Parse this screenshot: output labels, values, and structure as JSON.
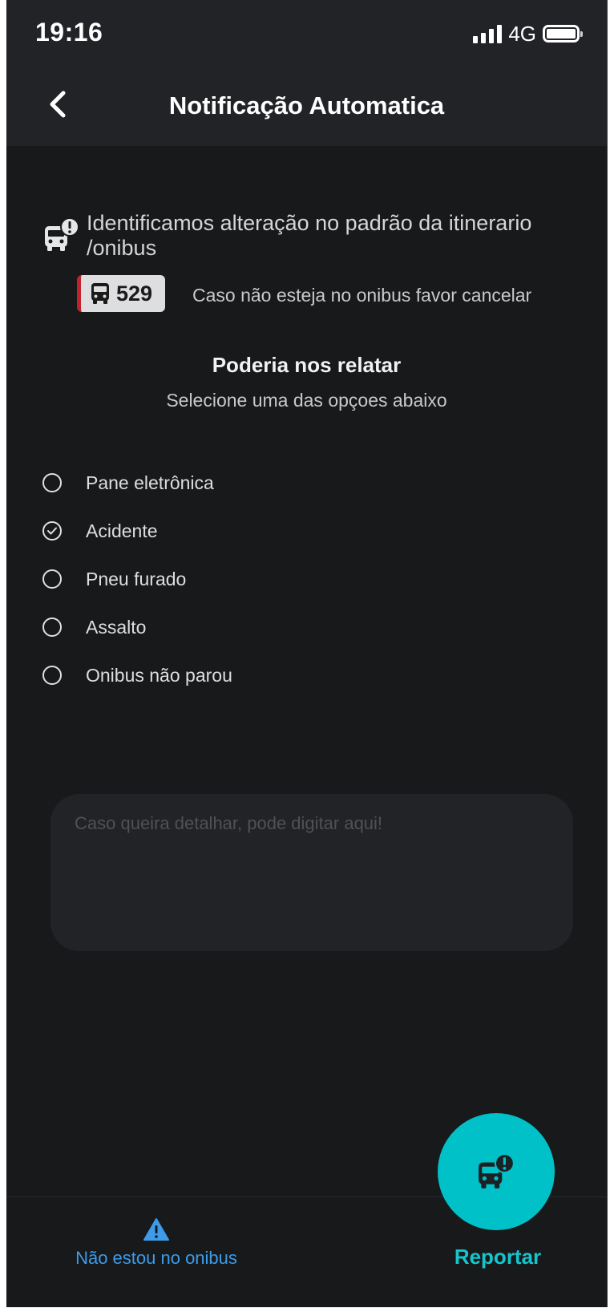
{
  "status_bar": {
    "time": "19:16",
    "network": "4G"
  },
  "header": {
    "title": "Notificação Automatica",
    "back_icon": "chevron-left-icon"
  },
  "notice": {
    "icon": "bus-alert-icon",
    "text": "Identificamos alteração no padrão da itinerario /onibus",
    "bus_line": "529",
    "bus_line_color": "#c2232a",
    "cancel_hint": "Caso não esteja no onibus favor cancelar"
  },
  "report_section": {
    "title": "Poderia nos relatar",
    "subtitle": "Selecione uma das opçoes abaixo",
    "options": [
      {
        "label": "Pane eletrônica",
        "selected": false
      },
      {
        "label": "Acidente",
        "selected": true
      },
      {
        "label": "Pneu furado",
        "selected": false
      },
      {
        "label": "Assalto",
        "selected": false
      },
      {
        "label": "Onibus não parou",
        "selected": false
      }
    ],
    "details_placeholder": "Caso queira detalhar, pode digitar aqui!",
    "details_value": ""
  },
  "bottom": {
    "not_on_bus_label": "Não estou no onibus",
    "not_on_bus_icon": "warning-icon",
    "report_label": "Reportar",
    "report_icon": "bus-alert-icon",
    "accent_color": "#00c0c8",
    "link_color": "#3d9be9"
  }
}
